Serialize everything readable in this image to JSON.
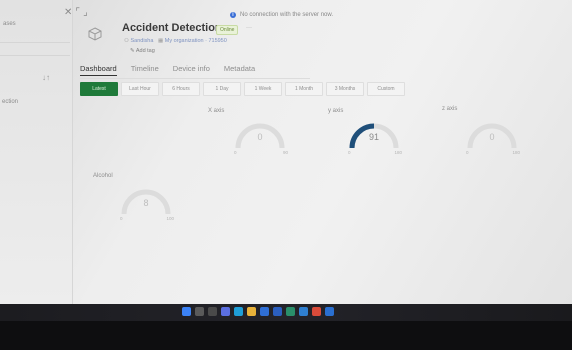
{
  "sidebar": {
    "top_text": "ases",
    "item_text": "ection",
    "sort_icon": "sort-arrows-icon"
  },
  "window": {
    "close_icon": "close-icon",
    "expand_icon": "expand-icon"
  },
  "notice": {
    "text": "No connection with the server now."
  },
  "device": {
    "title": "Accident Detection",
    "status": "Online",
    "more_label": "···",
    "owner": "Sandisha",
    "org": "My organization · 715950",
    "add_tag": "Add tag"
  },
  "tabs": [
    {
      "label": "Dashboard",
      "active": true
    },
    {
      "label": "Timeline",
      "active": false
    },
    {
      "label": "Device info",
      "active": false
    },
    {
      "label": "Metadata",
      "active": false
    }
  ],
  "ranges": [
    {
      "label": "Latest",
      "active": true
    },
    {
      "label": "Last Hour",
      "active": false
    },
    {
      "label": "6 Hours",
      "active": false
    },
    {
      "label": "1 Day",
      "active": false
    },
    {
      "label": "1 Week",
      "active": false
    },
    {
      "label": "1 Month",
      "active": false
    },
    {
      "label": "3 Months",
      "active": false
    },
    {
      "label": "Custom",
      "active": false
    }
  ],
  "gauges": [
    {
      "label": "X axis",
      "value": "0",
      "min": "0",
      "max": "90",
      "fill": 0,
      "accent": "#c9c9c9"
    },
    {
      "label": "y axis",
      "value": "91",
      "min": "0",
      "max": "180",
      "fill": 0.5,
      "accent": "#1f4f7a"
    },
    {
      "label": "z axis",
      "value": "0",
      "min": "0",
      "max": "180",
      "fill": 0,
      "accent": "#c9c9c9"
    },
    {
      "label": "Alcohol",
      "value": "8",
      "min": "0",
      "max": "100",
      "fill": 0,
      "accent": "#c9c9c9"
    }
  ],
  "taskbar": [
    {
      "icon": "windows-start-icon",
      "color": "#3b82f6"
    },
    {
      "icon": "search-icon",
      "color": "#5a5a5a"
    },
    {
      "icon": "task-view-icon",
      "color": "#4a4a4a"
    },
    {
      "icon": "chat-icon",
      "color": "#5b6fe0"
    },
    {
      "icon": "edge-browser-icon",
      "color": "#1f9fd8"
    },
    {
      "icon": "file-explorer-icon",
      "color": "#e8b23a"
    },
    {
      "icon": "store-icon",
      "color": "#2f6fd6"
    },
    {
      "icon": "mail-icon",
      "color": "#2b5fbf"
    },
    {
      "icon": "photos-icon",
      "color": "#2a8f6a"
    },
    {
      "icon": "security-icon",
      "color": "#2f7fd0"
    },
    {
      "icon": "chrome-icon",
      "color": "#d94b3a"
    },
    {
      "icon": "app-icon",
      "color": "#2a6fd0"
    }
  ]
}
